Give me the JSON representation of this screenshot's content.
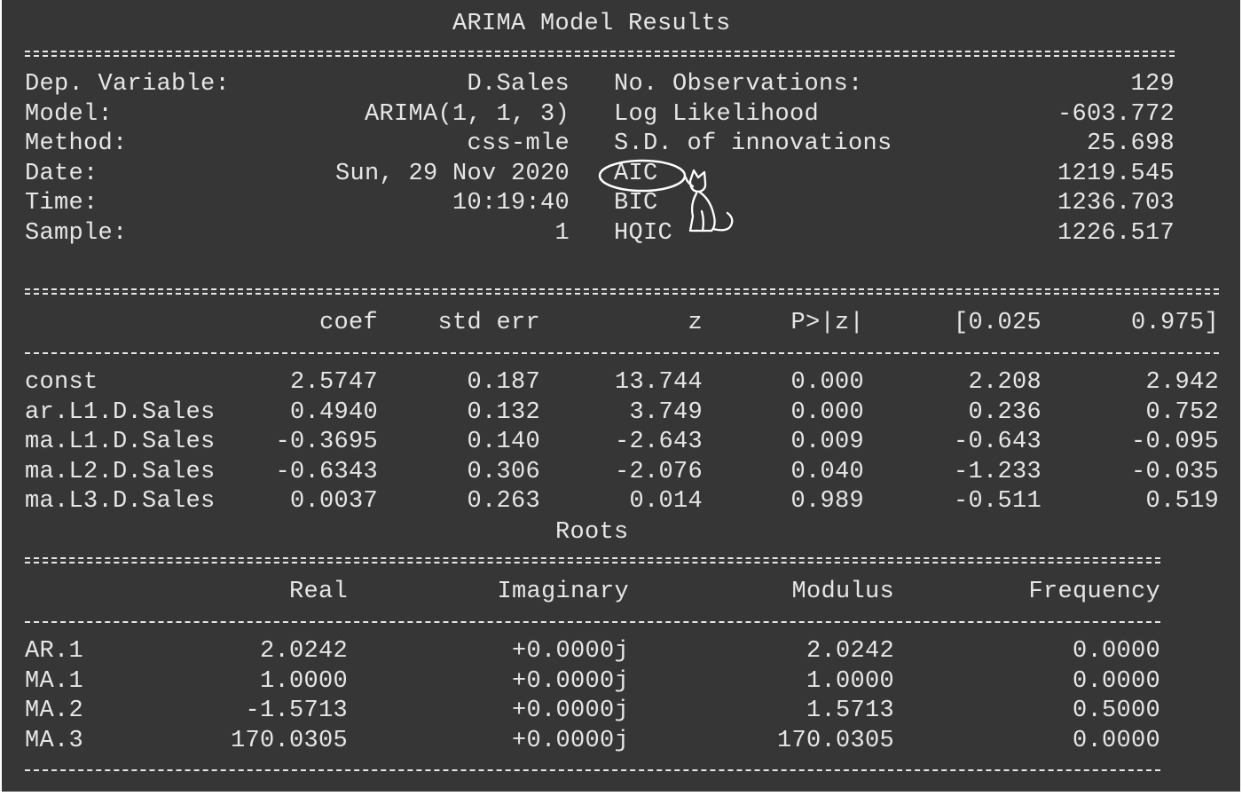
{
  "title": "ARIMA Model Results",
  "info_left": [
    {
      "label": "Dep. Variable:",
      "value": "D.Sales"
    },
    {
      "label": "Model:",
      "value": "ARIMA(1, 1, 3)"
    },
    {
      "label": "Method:",
      "value": "css-mle"
    },
    {
      "label": "Date:",
      "value": "Sun, 29 Nov 2020"
    },
    {
      "label": "Time:",
      "value": "10:19:40"
    },
    {
      "label": "Sample:",
      "value": "1"
    }
  ],
  "info_right": [
    {
      "label": "No. Observations:",
      "value": "129"
    },
    {
      "label": "Log Likelihood",
      "value": "-603.772"
    },
    {
      "label": "S.D. of innovations",
      "value": "25.698"
    },
    {
      "label": "AIC",
      "value": "1219.545"
    },
    {
      "label": "BIC",
      "value": "1236.703"
    },
    {
      "label": "HQIC",
      "value": "1226.517"
    }
  ],
  "coef_headers": [
    "coef",
    "std err",
    "z",
    "P>|z|",
    "[0.025",
    "0.975]"
  ],
  "coef_rows": [
    {
      "name": "const",
      "values": [
        "2.5747",
        "0.187",
        "13.744",
        "0.000",
        "2.208",
        "2.942"
      ]
    },
    {
      "name": "ar.L1.D.Sales",
      "values": [
        "0.4940",
        "0.132",
        "3.749",
        "0.000",
        "0.236",
        "0.752"
      ]
    },
    {
      "name": "ma.L1.D.Sales",
      "values": [
        "-0.3695",
        "0.140",
        "-2.643",
        "0.009",
        "-0.643",
        "-0.095"
      ]
    },
    {
      "name": "ma.L2.D.Sales",
      "values": [
        "-0.6343",
        "0.306",
        "-2.076",
        "0.040",
        "-1.233",
        "-0.035"
      ]
    },
    {
      "name": "ma.L3.D.Sales",
      "values": [
        "0.0037",
        "0.263",
        "0.014",
        "0.989",
        "-0.511",
        "0.519"
      ]
    }
  ],
  "roots_title": "Roots",
  "roots_headers": [
    "Real",
    "Imaginary",
    "Modulus",
    "Frequency"
  ],
  "roots_rows": [
    {
      "name": "AR.1",
      "values": [
        "2.0242",
        "+0.0000j",
        "2.0242",
        "0.0000"
      ]
    },
    {
      "name": "MA.1",
      "values": [
        "1.0000",
        "+0.0000j",
        "1.0000",
        "0.0000"
      ]
    },
    {
      "name": "MA.2",
      "values": [
        "-1.5713",
        "+0.0000j",
        "1.5713",
        "0.5000"
      ]
    },
    {
      "name": "MA.3",
      "values": [
        "170.0305",
        "+0.0000j",
        "170.0305",
        "0.0000"
      ]
    }
  ],
  "colors": {
    "background": "#363636",
    "text": "#e6e6e6",
    "annotation": "#ffffff"
  },
  "annotation_icon": "cat-circling-aic-icon"
}
